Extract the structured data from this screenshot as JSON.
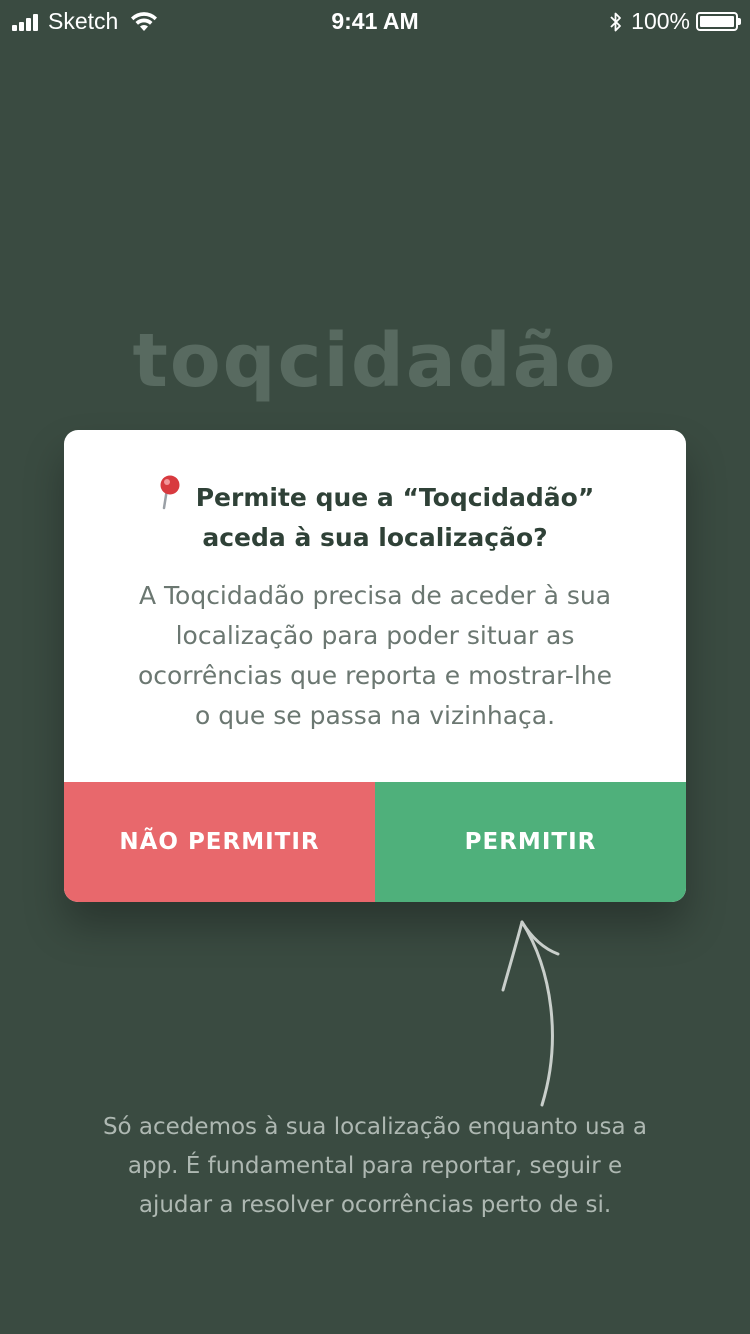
{
  "status_bar": {
    "carrier": "Sketch",
    "time": "9:41 AM",
    "battery": "100%"
  },
  "app_logo": "toqcidadão",
  "dialog": {
    "title_line1": "Permite que a “Toqcidadão”",
    "title_line2": "aceda à sua localização?",
    "body_lines": [
      "A Toqcidadão precisa de aceder à sua",
      "localização para poder situar as",
      "ocorrências que reporta e mostrar-lhe",
      "o que se passa na vizinhaça."
    ],
    "deny_label": "NÃO PERMITIR",
    "allow_label": "PERMITIR",
    "colors": {
      "deny": "#e8686c",
      "allow": "#4fb07b"
    }
  },
  "footnote_lines": [
    "Só acedemos à sua localização enquanto usa a",
    "app. É fundamental para reportar, seguir e",
    "ajudar a resolver ocorrências perto de si."
  ],
  "icons": {
    "pin": "map-pin-icon",
    "arrow": "curved-arrow-up-icon"
  },
  "colors": {
    "background": "#3a4b41"
  }
}
